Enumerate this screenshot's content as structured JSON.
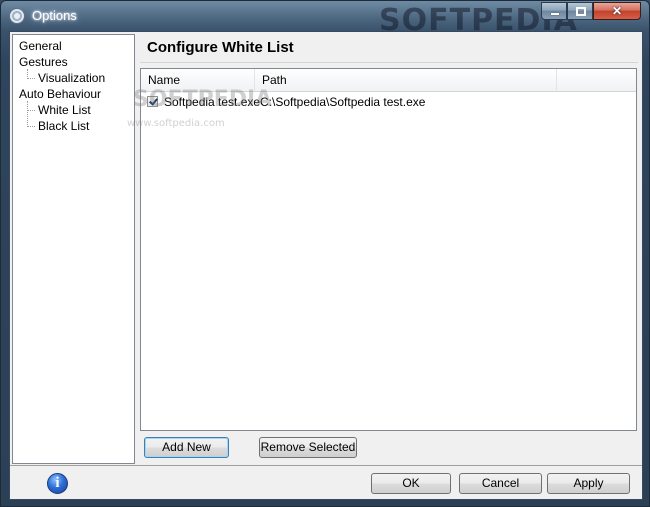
{
  "window": {
    "title": "Options",
    "watermark": "SOFTPEDIA"
  },
  "tree": {
    "items": [
      {
        "label": "General"
      },
      {
        "label": "Gestures"
      },
      {
        "label": "Visualization"
      },
      {
        "label": "Auto Behaviour"
      },
      {
        "label": "White List"
      },
      {
        "label": "Black List"
      }
    ]
  },
  "pane": {
    "title": "Configure White List",
    "columns": [
      "Name",
      "Path",
      ""
    ],
    "rows": [
      {
        "checked": true,
        "name": "Softpedia test.exe",
        "path": "C:\\Softpedia\\Softpedia test.exe"
      }
    ],
    "watermark_big": "SOFTPEDIA",
    "watermark_small": "www.softpedia.com"
  },
  "buttons": {
    "add_new": "Add New",
    "remove_selected": "Remove Selected",
    "ok": "OK",
    "cancel": "Cancel",
    "apply": "Apply"
  },
  "icons": {
    "app": "gear-icon",
    "info": "info-icon",
    "info_glyph": "i"
  }
}
